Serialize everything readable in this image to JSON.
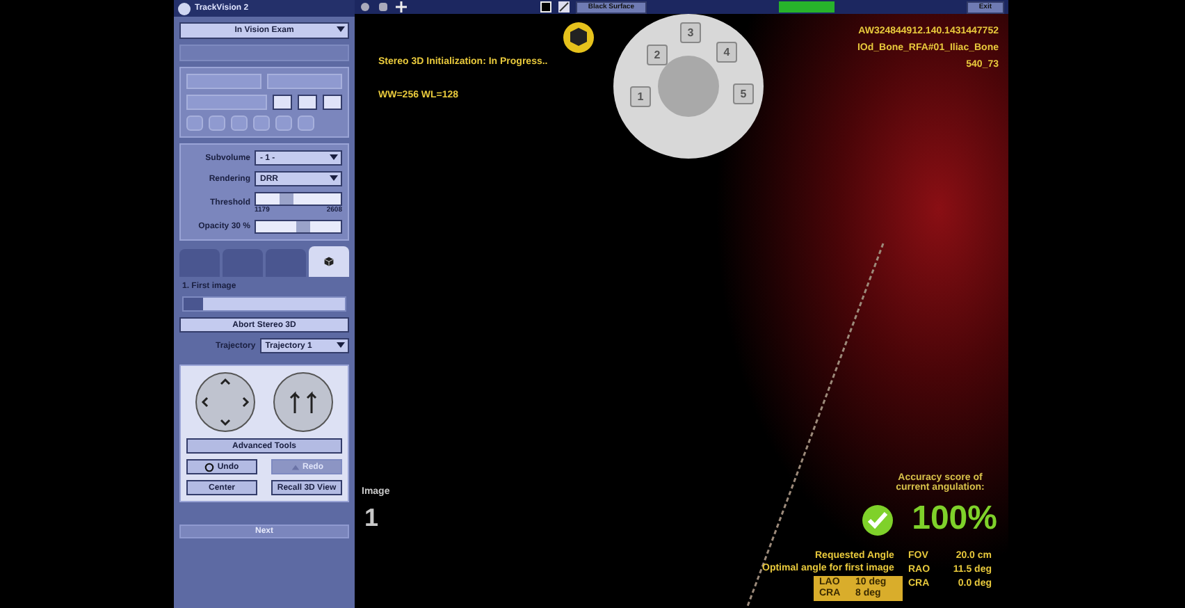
{
  "app": {
    "title": "TrackVision 2"
  },
  "panel": {
    "exam_select": "In Vision Exam",
    "render_rows": [
      {
        "kind": "select",
        "label": "Subvolume",
        "value": "- 1 -"
      },
      {
        "kind": "select",
        "label": "Rendering",
        "value": "DRR"
      },
      {
        "kind": "slider",
        "label": "Threshold",
        "level": 0.35,
        "min": "1179",
        "max": "2608"
      },
      {
        "kind": "slider",
        "label": "Opacity",
        "reading": "30 %",
        "level": 0.6
      }
    ],
    "tabs": [
      {
        "selected": false
      },
      {
        "selected": false
      },
      {
        "selected": false
      },
      {
        "selected": true
      }
    ],
    "step": {
      "title": "1. First image",
      "level": 0.12
    },
    "abort_button": "Abort Stereo 3D",
    "trajectory": {
      "label": "Trajectory",
      "value": "Trajectory 1"
    },
    "advanced_button": "Advanced Tools",
    "buttons": [
      {
        "kind": "undo",
        "label": "Undo",
        "disabled": false
      },
      {
        "kind": "redo",
        "label": "Redo",
        "disabled": true
      },
      {
        "kind": "plain",
        "label": "Center",
        "disabled": false
      },
      {
        "kind": "plain",
        "label": "Recall 3D View",
        "disabled": false
      }
    ],
    "next_button": {
      "label": "Next",
      "disabled": true
    }
  },
  "toolbar": {
    "surface_button": "Black Surface",
    "exit_button": "Exit"
  },
  "viewer": {
    "status": "Stereo 3D Initialization: In Progress..",
    "window_level": "WW=256 WL=128",
    "info": [
      "AW324844912.140.1431447752",
      "IOd_Bone_RFA#01_Iliac_Bone",
      "540_73"
    ],
    "dial_keys": [
      "1",
      "2",
      "3",
      "4",
      "5"
    ],
    "image_label": "Image",
    "image_number": "1",
    "accuracy": {
      "caption": "Accuracy score of current angulation:",
      "score": "100%"
    },
    "requested": {
      "title": "Requested Angle",
      "subtitle": "Optimal angle for first image",
      "rows": [
        [
          "LAO",
          "10 deg"
        ],
        [
          "CRA",
          "8 deg"
        ]
      ]
    },
    "fov": {
      "label": "FOV",
      "value": "20.0 cm",
      "rows": [
        [
          "RAO",
          "11.5 deg"
        ],
        [
          "CRA",
          "0.0 deg"
        ]
      ]
    }
  }
}
